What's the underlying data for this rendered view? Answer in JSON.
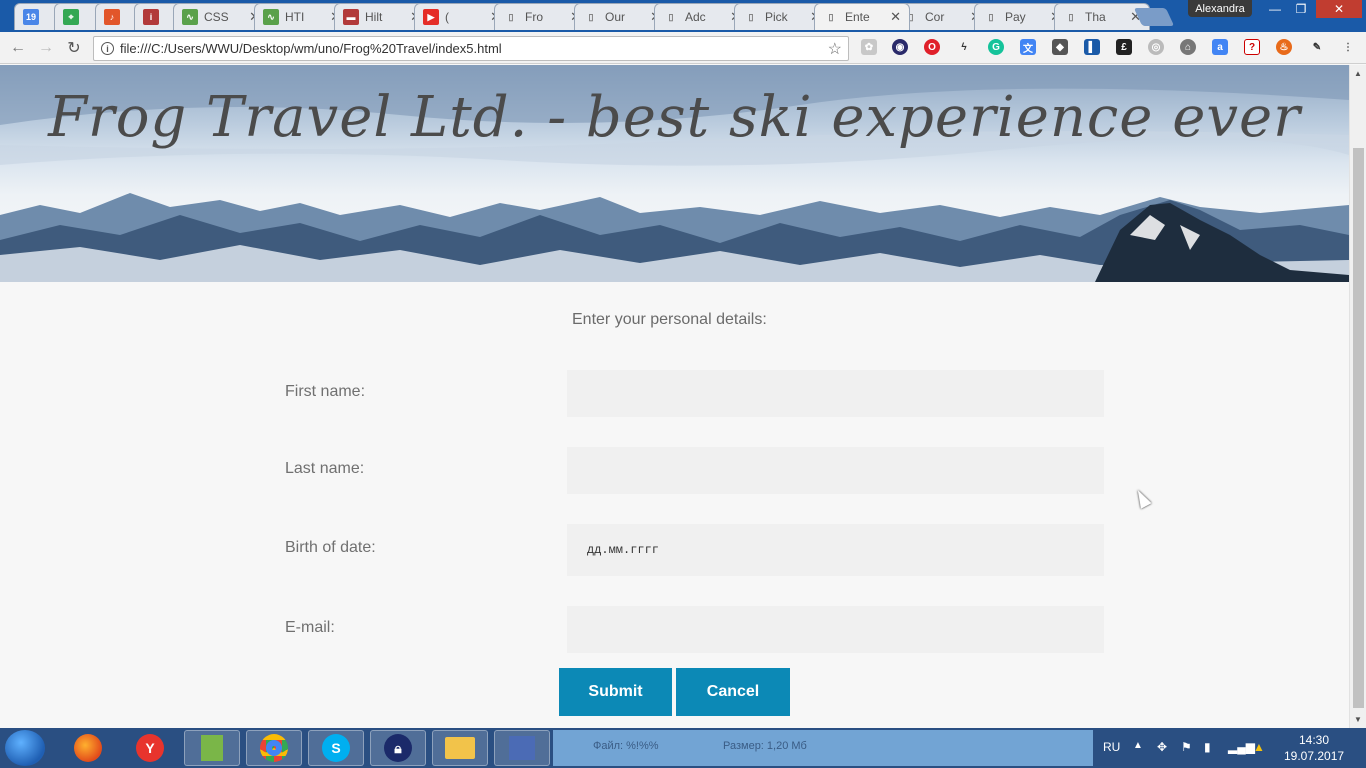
{
  "browser": {
    "profile_name": "Alexandra",
    "url": "file:///C:/Users/WWU/Desktop/wm/uno/Frog%20Travel/index5.html",
    "tabs": [
      {
        "label": "",
        "icon": "calendar-icon",
        "color": "#4a86e8"
      },
      {
        "label": "",
        "icon": "maps-icon",
        "color": "#34a853"
      },
      {
        "label": "",
        "icon": "music-icon",
        "color": "#e2562a"
      },
      {
        "label": "",
        "icon": "info-icon",
        "color": "#b23a3a"
      },
      {
        "label": "CSS",
        "icon": "tab-favicon",
        "color": "#5aa14a"
      },
      {
        "label": "HTI",
        "icon": "tab-favicon",
        "color": "#5aa14a"
      },
      {
        "label": "Hilt",
        "icon": "tab-favicon",
        "color": "#b23a3a"
      },
      {
        "label": "(",
        "icon": "youtube-icon",
        "color": "#e52d27"
      },
      {
        "label": "Fro",
        "icon": "page-icon",
        "color": "#9aa0a6"
      },
      {
        "label": "Our",
        "icon": "page-icon",
        "color": "#9aa0a6"
      },
      {
        "label": "Adc",
        "icon": "page-icon",
        "color": "#9aa0a6"
      },
      {
        "label": "Pick",
        "icon": "page-icon",
        "color": "#9aa0a6"
      },
      {
        "label": "Ente",
        "icon": "page-icon",
        "color": "#9aa0a6"
      },
      {
        "label": "Cor",
        "icon": "page-icon",
        "color": "#9aa0a6"
      },
      {
        "label": "Pay",
        "icon": "page-icon",
        "color": "#9aa0a6"
      },
      {
        "label": "Tha",
        "icon": "page-icon",
        "color": "#9aa0a6"
      }
    ],
    "active_tab_index": 12
  },
  "page": {
    "site_title": "Frog Travel Ltd. - best ski experience ever",
    "form": {
      "heading": "Enter your personal details:",
      "fields": [
        {
          "label": "First name:",
          "value": "",
          "placeholder": ""
        },
        {
          "label": "Last name:",
          "value": "",
          "placeholder": ""
        },
        {
          "label": "Birth of date:",
          "value": "",
          "placeholder": "дд.мм.гггг"
        },
        {
          "label": "E-mail:",
          "value": "",
          "placeholder": ""
        }
      ],
      "submit_label": "Submit",
      "cancel_label": "Cancel"
    },
    "accent_color": "#0c89b6"
  },
  "taskbar": {
    "language": "RU",
    "time": "14:30",
    "date": "19.07.2017",
    "middle_texts": [
      "Файл: %!%%",
      "Размер: 1,20 Мб"
    ]
  }
}
